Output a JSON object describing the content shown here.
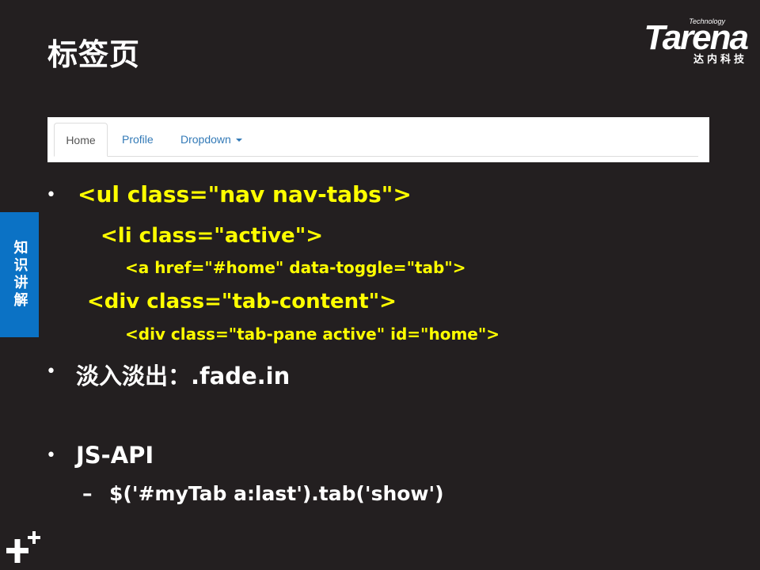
{
  "slide": {
    "title": "标签页",
    "side_label": "知识讲解"
  },
  "logo": {
    "technology": "Technology",
    "brand": "Tarena",
    "chinese": "达内科技"
  },
  "demo_tabs": {
    "tabs": [
      {
        "label": "Home",
        "active": true
      },
      {
        "label": "Profile",
        "active": false
      },
      {
        "label": "Dropdown",
        "active": false
      }
    ]
  },
  "bullets": {
    "marker": "•",
    "dash": "–",
    "code_ul": "<ul class=\"nav nav-tabs\">",
    "code_li": "<li  class=\"active\">",
    "code_a": "<a href=\"#home\" data-toggle=\"tab\">",
    "code_div": "<div class=\"tab-content\">",
    "code_pane": "<div  class=\"tab-pane active\" id=\"home\">",
    "fade": "淡入淡出：.fade.in",
    "jsapi": "JS-API",
    "jsapi_example": "$('#myTab a:last').tab('show')"
  },
  "colors": {
    "background": "#231f20",
    "code_yellow": "#ffff00",
    "side_blue": "#0b72c5",
    "tab_link": "#337ab7"
  }
}
